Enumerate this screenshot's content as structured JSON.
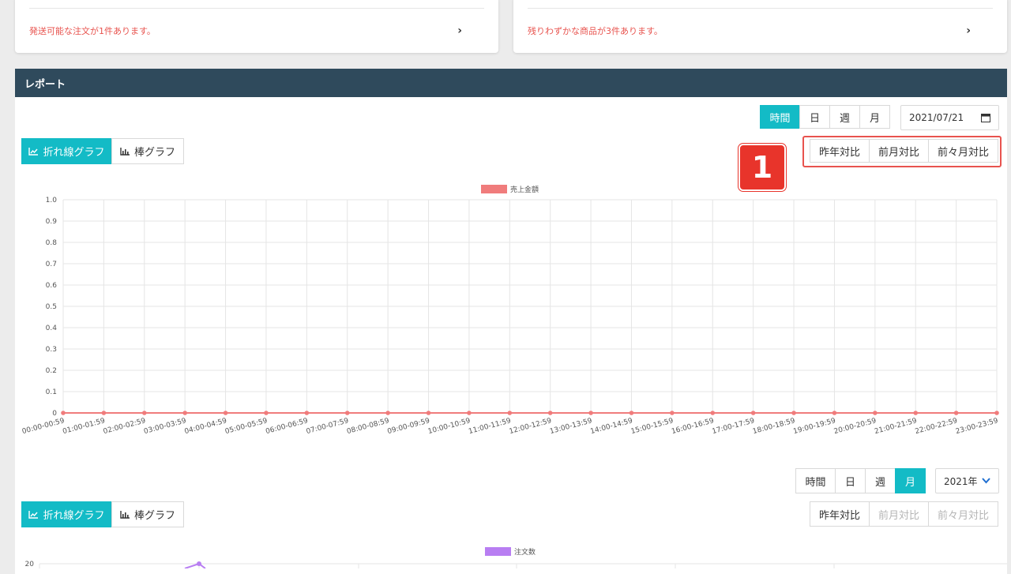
{
  "notices": {
    "left": "発送可能な注文が1件あります。",
    "right": "残りわずかな商品が3件あります。"
  },
  "report": {
    "title": "レポート",
    "period_buttons": [
      "時間",
      "日",
      "週",
      "月"
    ],
    "date_value": "2021/07/21",
    "chart_type_buttons": {
      "line": "折れ線グラフ",
      "bar": "棒グラフ"
    },
    "compare_buttons": [
      "昨年対比",
      "前月対比",
      "前々月対比"
    ],
    "badge": "1",
    "year_select": "2021年"
  },
  "colors": {
    "accent": "#13bbc6",
    "header": "#2f4a5c",
    "sales": "#f07c7c",
    "orders": "#b87ef2",
    "highlight": "#e8534e"
  },
  "chart_data": [
    {
      "type": "line",
      "legend": "売上金額",
      "categories": [
        "00:00-00:59",
        "01:00-01:59",
        "02:00-02:59",
        "03:00-03:59",
        "04:00-04:59",
        "05:00-05:59",
        "06:00-06:59",
        "07:00-07:59",
        "08:00-08:59",
        "09:00-09:59",
        "10:00-10:59",
        "11:00-11:59",
        "12:00-12:59",
        "13:00-13:59",
        "14:00-14:59",
        "15:00-15:59",
        "16:00-16:59",
        "17:00-17:59",
        "18:00-18:59",
        "19:00-19:59",
        "20:00-20:59",
        "21:00-21:59",
        "22:00-22:59",
        "23:00-23:59"
      ],
      "values": [
        0,
        0,
        0,
        0,
        0,
        0,
        0,
        0,
        0,
        0,
        0,
        0,
        0,
        0,
        0,
        0,
        0,
        0,
        0,
        0,
        0,
        0,
        0,
        0
      ],
      "yticks": [
        "1.0",
        "0.9",
        "0.8",
        "0.7",
        "0.6",
        "0.5",
        "0.4",
        "0.3",
        "0.2",
        "0.1",
        "0"
      ],
      "ylim": [
        0,
        1
      ]
    },
    {
      "type": "line",
      "legend": "注文数",
      "ytick_top": "20"
    }
  ]
}
